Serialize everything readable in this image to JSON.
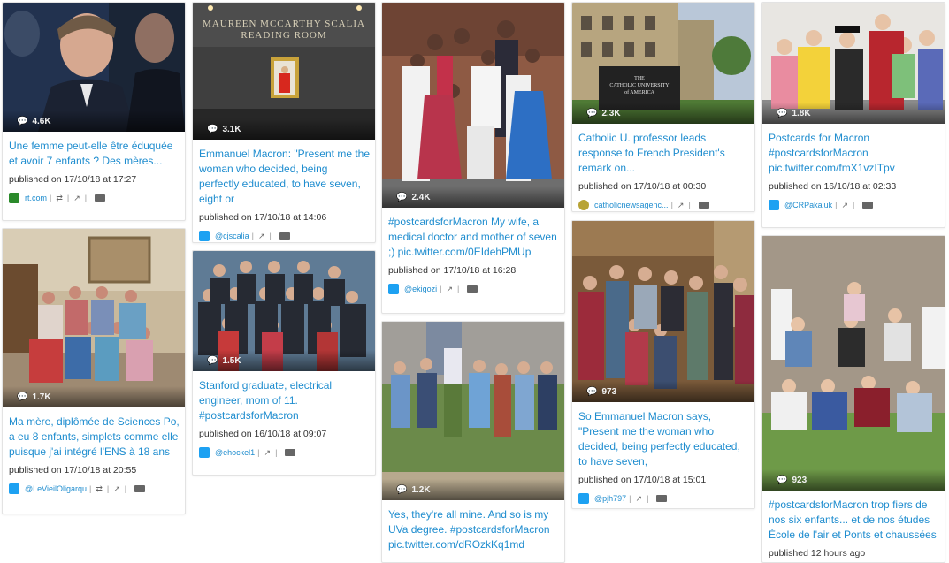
{
  "cards": [
    {
      "title": "Une femme peut-elle être éduquée et avoir 7 enfants ? Des mères...",
      "count": "4.6K",
      "published": "published on 17/10/18 at 17:27",
      "source": "rt.com",
      "logo_color": "#2b8a2b",
      "logo_text": "RT"
    },
    {
      "title": "Ma mère, diplômée de Sciences Po, a eu 8 enfants, simplets comme elle puisque j'ai intégré l'ENS à 18 ans",
      "count": "1.7K",
      "published": "published on 17/10/18 at 20:55",
      "source": "@LeVieilOligarqu",
      "logo_color": "#1da1f2",
      "logo_text": ""
    },
    {
      "title": "Emmanuel Macron: \"Present me the woman who decided, being perfectly educated, to have seven, eight or",
      "count": "3.1K",
      "published": "published on 17/10/18 at 14:06",
      "source": "@cjscalia",
      "logo_color": "#1da1f2",
      "logo_text": "",
      "img_text1": "MAUREEN MCCARTHY SCALIA",
      "img_text2": "READING ROOM"
    },
    {
      "title": "Stanford graduate, electrical engineer, mom of 11. #postcardsforMacron",
      "count": "1.5K",
      "published": "published on 16/10/18 at 09:07",
      "source": "@ehockel1",
      "logo_color": "#1da1f2",
      "logo_text": ""
    },
    {
      "title": "#postcardsforMacron My wife, a medical doctor and mother of seven ;) pic.twitter.com/0EIdehPMUp",
      "count": "2.4K",
      "published": "published on 17/10/18 at 16:28",
      "source": "@ekigozi",
      "logo_color": "#1da1f2",
      "logo_text": ""
    },
    {
      "title": "Yes, they're all mine. And so is my UVa degree. #postcardsforMacron pic.twitter.com/dROzkKq1md",
      "count": "1.2K",
      "published": "",
      "source": "",
      "logo_color": "#1da1f2",
      "logo_text": ""
    },
    {
      "title": "Catholic U. professor leads response to French President's remark on...",
      "count": "2.3K",
      "published": "published on 17/10/18 at 00:30",
      "source": "catholicnewsagenc...",
      "logo_color": "#b8a335",
      "logo_text": "",
      "img_text1": "THE",
      "img_text2": "CATHOLIC UNIVERSITY",
      "img_text3": "of AMERICA"
    },
    {
      "title": "So Emmanuel Macron says, \"Present me the woman who decided, being perfectly educated, to have seven,",
      "count": "973",
      "published": "published on 17/10/18 at 15:01",
      "source": "@pjh797",
      "logo_color": "#1da1f2",
      "logo_text": ""
    },
    {
      "title": "Postcards for Macron #postcardsforMacron pic.twitter.com/fmX1vzITpv",
      "count": "1.8K",
      "published": "published on 16/10/18 at 02:33",
      "source": "@CRPakaluk",
      "logo_color": "#1da1f2",
      "logo_text": ""
    },
    {
      "title": "#postcardsforMacron trop fiers de nos six enfants... et de nos études École de l'air et Ponts et chaussées",
      "count": "923",
      "published": "published 12 hours ago",
      "source": "",
      "logo_color": "#1da1f2",
      "logo_text": ""
    }
  ],
  "icons": {
    "bubble": "speech-bubble-icon",
    "external": "external-link-icon",
    "folder": "folder-icon",
    "translate": "translate-icon"
  }
}
